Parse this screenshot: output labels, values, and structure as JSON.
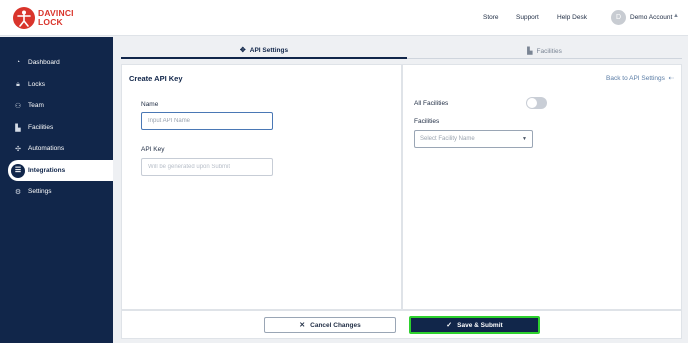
{
  "brand": {
    "line1": "DAVINCI",
    "line2": "LOCK",
    "color": "#d9342b"
  },
  "header": {
    "links": [
      "Store",
      "Support",
      "Help Desk"
    ],
    "account": {
      "initial": "D",
      "name": "Demo Account"
    }
  },
  "sidebar": {
    "items": [
      {
        "label": "Dashboard",
        "icon": "gauge-icon"
      },
      {
        "label": "Locks",
        "icon": "lock-icon"
      },
      {
        "label": "Team",
        "icon": "team-icon"
      },
      {
        "label": "Facilities",
        "icon": "building-icon"
      },
      {
        "label": "Automations",
        "icon": "automation-icon"
      },
      {
        "label": "Integrations",
        "icon": "integrations-icon",
        "active": true
      },
      {
        "label": "Settings",
        "icon": "gear-icon"
      }
    ]
  },
  "tabs": [
    {
      "label": "API Settings",
      "active": true
    },
    {
      "label": "Facilities",
      "active": false
    }
  ],
  "form": {
    "title": "Create API Key",
    "name_label": "Name",
    "name_placeholder": "Input API Name",
    "apikey_label": "API Key",
    "apikey_placeholder": "Will be generated upon Submit"
  },
  "right": {
    "back_link": "Back to API Settings",
    "all_facilities_label": "All Facilities",
    "all_facilities_on": false,
    "facilities_label": "Facilities",
    "facility_placeholder": "Select Facility Name"
  },
  "footer": {
    "cancel_label": "Cancel Changes",
    "save_label": "Save & Submit"
  },
  "colors": {
    "sidebar_bg": "#11264a",
    "accent": "#11264a",
    "save_outline": "#2ed12e",
    "link": "#5b7da6"
  }
}
